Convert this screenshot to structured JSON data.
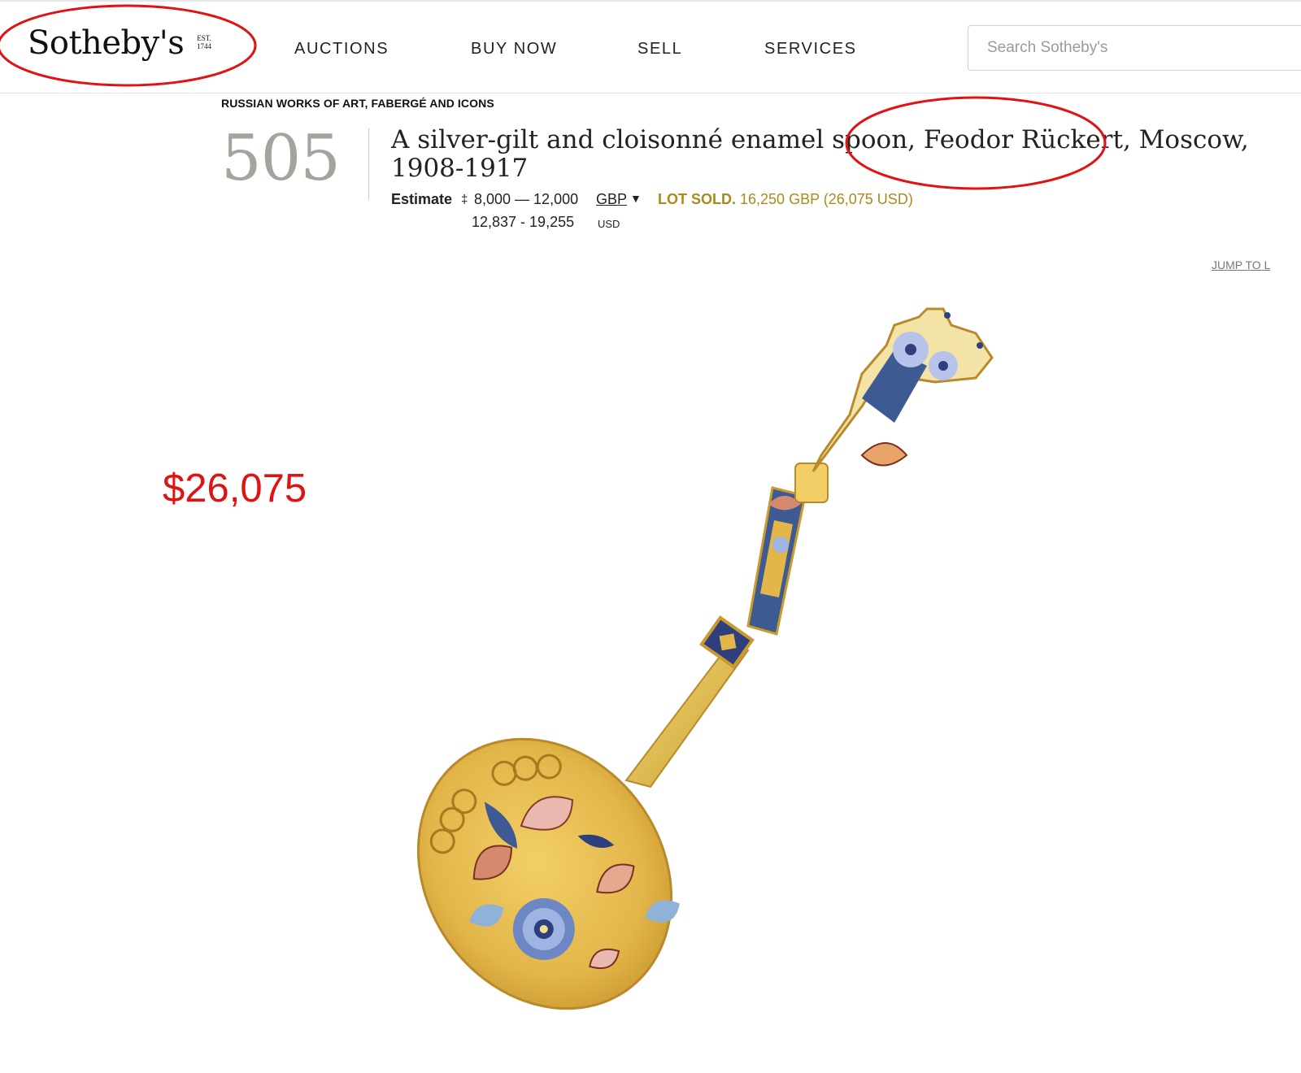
{
  "header": {
    "logo": "Sotheby's",
    "logo_est": [
      "EST.",
      "1744"
    ],
    "nav": [
      "AUCTIONS",
      "BUY NOW",
      "SELL",
      "SERVICES"
    ],
    "search_placeholder": "Search Sotheby's"
  },
  "lot": {
    "category": "RUSSIAN WORKS OF ART, FABERGÉ AND ICONS",
    "number": "505",
    "title": "A silver-gilt and cloisonné enamel spoon, Feodor Rückert, Moscow, 1908-1917",
    "estimate_label": "Estimate",
    "dagger": "‡",
    "estimate_range": "8,000 — 12,000",
    "currency": "GBP",
    "currency_caret": "▼",
    "sold_label": "LOT SOLD.",
    "sold_value": "16,250 GBP (26,075 USD)",
    "usd_range": "12,837 - 19,255",
    "usd_label": "USD"
  },
  "jump_link": "JUMP TO L",
  "annotation_price": "$26,075",
  "colors": {
    "annotation_red": "#e01212",
    "sold_gold": "#a98a1c",
    "lot_number_gray": "#a5a39c"
  },
  "icons": [
    "dropdown-caret-icon"
  ],
  "image": "silver-gilt cloisonné enamel spoon"
}
